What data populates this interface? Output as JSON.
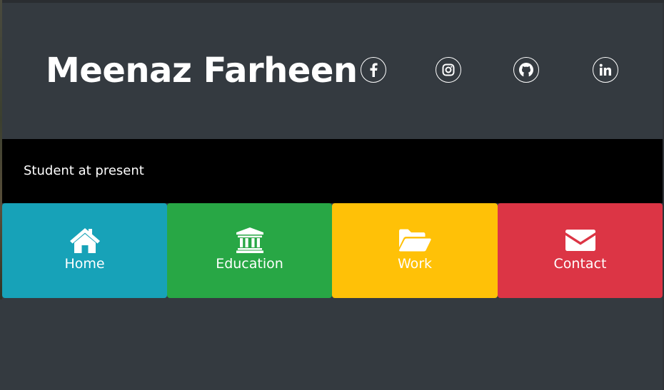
{
  "header": {
    "name": "Meenaz Farheen",
    "social": [
      {
        "icon": "facebook-icon"
      },
      {
        "icon": "instagram-icon"
      },
      {
        "icon": "github-icon"
      },
      {
        "icon": "linkedin-icon"
      }
    ]
  },
  "tagline": "Student at present",
  "nav": {
    "tiles": [
      {
        "label": "Home",
        "icon": "home-icon",
        "color": "#17a2b8"
      },
      {
        "label": "Education",
        "icon": "university-icon",
        "color": "#28a745"
      },
      {
        "label": "Work",
        "icon": "folder-open-icon",
        "color": "#ffc107"
      },
      {
        "label": "Contact",
        "icon": "envelope-icon",
        "color": "#dc3545"
      }
    ]
  },
  "colors": {
    "background": "#343a40",
    "tagline_bar": "#000000",
    "text": "#ffffff"
  }
}
